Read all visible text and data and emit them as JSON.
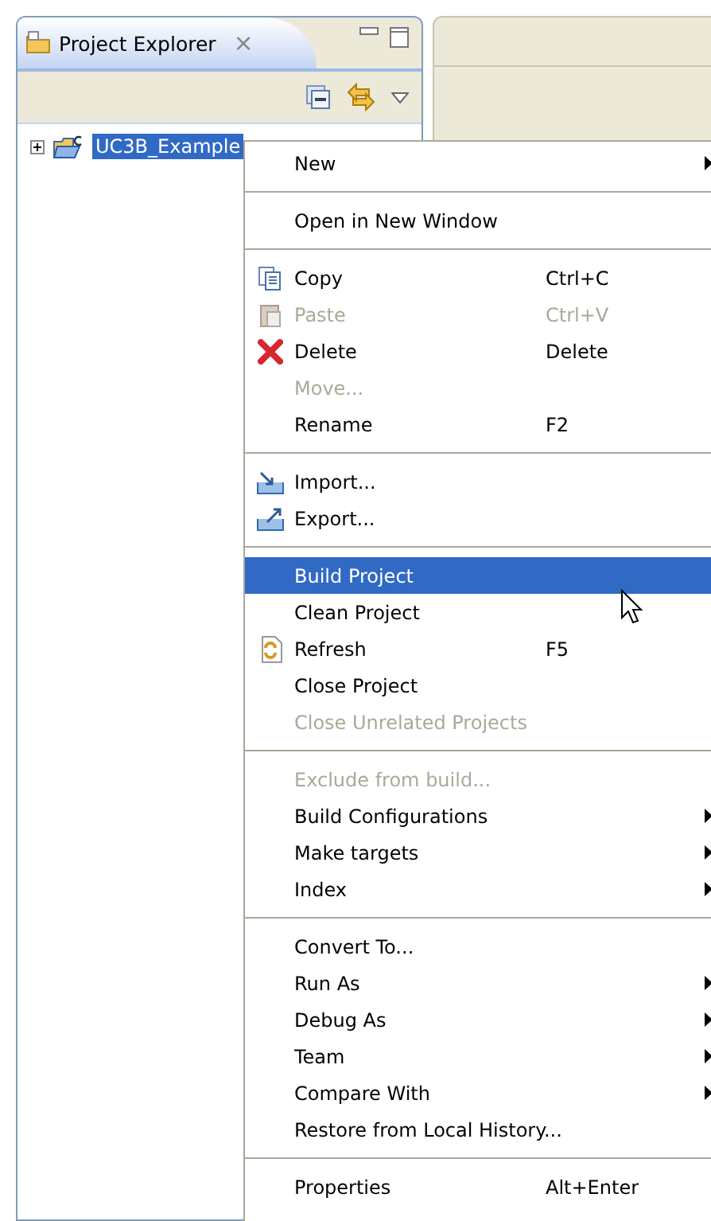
{
  "view": {
    "title": "Project Explorer",
    "close": "×"
  },
  "tree": [
    {
      "label": "UC3B_Example",
      "expanded": false,
      "selected": true
    }
  ],
  "menu": {
    "groups": [
      [
        {
          "label": "New",
          "submenu": true,
          "disabled": false,
          "selected": false
        }
      ],
      [
        {
          "label": "Open in New Window",
          "disabled": false,
          "selected": false
        }
      ],
      [
        {
          "label": "Copy",
          "shortcut": "Ctrl+C",
          "disabled": false,
          "selected": false
        },
        {
          "label": "Paste",
          "shortcut": "Ctrl+V",
          "disabled": true,
          "selected": false
        },
        {
          "label": "Delete",
          "shortcut": "Delete",
          "disabled": false,
          "selected": false
        },
        {
          "label": "Move...",
          "disabled": true,
          "selected": false
        },
        {
          "label": "Rename",
          "shortcut": "F2",
          "disabled": false,
          "selected": false
        }
      ],
      [
        {
          "label": "Import...",
          "disabled": false,
          "selected": false
        },
        {
          "label": "Export...",
          "disabled": false,
          "selected": false
        }
      ],
      [
        {
          "label": "Build Project",
          "disabled": false,
          "selected": true
        },
        {
          "label": "Clean Project",
          "disabled": false,
          "selected": false
        },
        {
          "label": "Refresh",
          "shortcut": "F5",
          "disabled": false,
          "selected": false
        },
        {
          "label": "Close Project",
          "disabled": false,
          "selected": false
        },
        {
          "label": "Close Unrelated Projects",
          "disabled": true,
          "selected": false
        }
      ],
      [
        {
          "label": "Exclude from build...",
          "disabled": true,
          "selected": false
        },
        {
          "label": "Build Configurations",
          "submenu": true,
          "disabled": false,
          "selected": false
        },
        {
          "label": "Make targets",
          "submenu": true,
          "disabled": false,
          "selected": false
        },
        {
          "label": "Index",
          "submenu": true,
          "disabled": false,
          "selected": false
        }
      ],
      [
        {
          "label": "Convert To...",
          "disabled": false,
          "selected": false
        },
        {
          "label": "Run As",
          "submenu": true,
          "disabled": false,
          "selected": false
        },
        {
          "label": "Debug As",
          "submenu": true,
          "disabled": false,
          "selected": false
        },
        {
          "label": "Team",
          "submenu": true,
          "disabled": false,
          "selected": false
        },
        {
          "label": "Compare With",
          "submenu": true,
          "disabled": false,
          "selected": false
        },
        {
          "label": "Restore from Local History...",
          "disabled": false,
          "selected": false
        }
      ],
      [
        {
          "label": "Properties",
          "shortcut": "Alt+Enter",
          "disabled": false,
          "selected": false
        }
      ]
    ]
  }
}
